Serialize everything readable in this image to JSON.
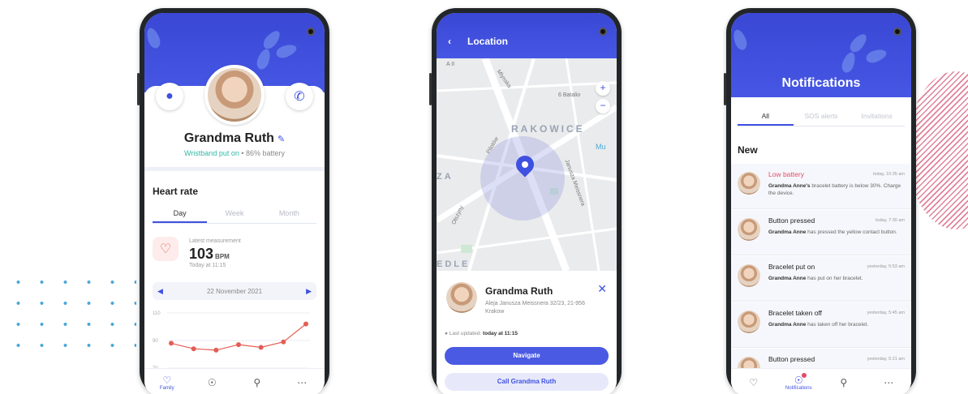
{
  "profile": {
    "name": "Grandma Ruth",
    "status_ok": "Wristband put on",
    "status_rest": " • 86% battery",
    "section_title": "Heart rate",
    "tabs": [
      "Day",
      "Week",
      "Month"
    ],
    "latest_label": "Latest measurement",
    "bpm_value": "103",
    "bpm_unit": "BPM",
    "time_label": "Today at 11:15",
    "date": "22 November 2021",
    "chart_ticks": [
      "110",
      "90",
      "70"
    ],
    "chart_values": [
      88,
      84,
      83,
      87,
      85,
      89,
      102
    ],
    "nav": {
      "active_label": "Family"
    }
  },
  "location": {
    "title": "Location",
    "map_labels": {
      "district": "RAKOWICE",
      "street1": "Mlynska",
      "street2": "6 Batalio",
      "street3": "Pilotów",
      "street4": "Janusza Meissnera",
      "street5": "Olszyny",
      "left1": "ZA",
      "left2": "EDLE",
      "mu": "Mu",
      "ii": "A II"
    },
    "card_name": "Grandma Ruth",
    "card_address": "Aleja Janusza Meissnera 32/23, 21-956 Krakow",
    "updated_prefix": "Last updated:",
    "updated_value": "today at 11:15",
    "navigate_label": "Navigate",
    "call_label": "Call Grandma Ruth"
  },
  "notifications": {
    "title": "Notifications",
    "tabs": [
      "All",
      "SOS alerts",
      "Invitations"
    ],
    "section": "New",
    "items": [
      {
        "title": "Low battery",
        "time": "today, 10:35 am",
        "who": "Grandma Anne's",
        "body": " bracelet battery is below 30%. Charge the device."
      },
      {
        "title": "Button pressed",
        "time": "today, 7:30 am",
        "who": "Grandma Anne",
        "body": " has pressed the yellow contact button."
      },
      {
        "title": "Bracelet put on",
        "time": "yesterday, 5:53 am",
        "who": "Grandma Anne",
        "body": " has put on her bracelet."
      },
      {
        "title": "Bracelet taken off",
        "time": "yesterday, 5:45 am",
        "who": "Grandma Anne",
        "body": " has taken off her bracelet."
      },
      {
        "title": "Button pressed",
        "time": "yesterday, 5:21 am",
        "who": "",
        "body": ""
      }
    ],
    "nav_active_label": "Notifications"
  },
  "colors": {
    "primary": "#3f51e0",
    "teal": "#2fb9a8",
    "alert": "#e54a66",
    "chart_line": "#e45d55"
  },
  "icons": [
    "map-pin-icon",
    "phone-icon",
    "edit-icon",
    "heart-icon",
    "bell-icon",
    "location-icon",
    "more-icon",
    "back-icon",
    "close-icon",
    "zoom-in-icon",
    "zoom-out-icon"
  ]
}
